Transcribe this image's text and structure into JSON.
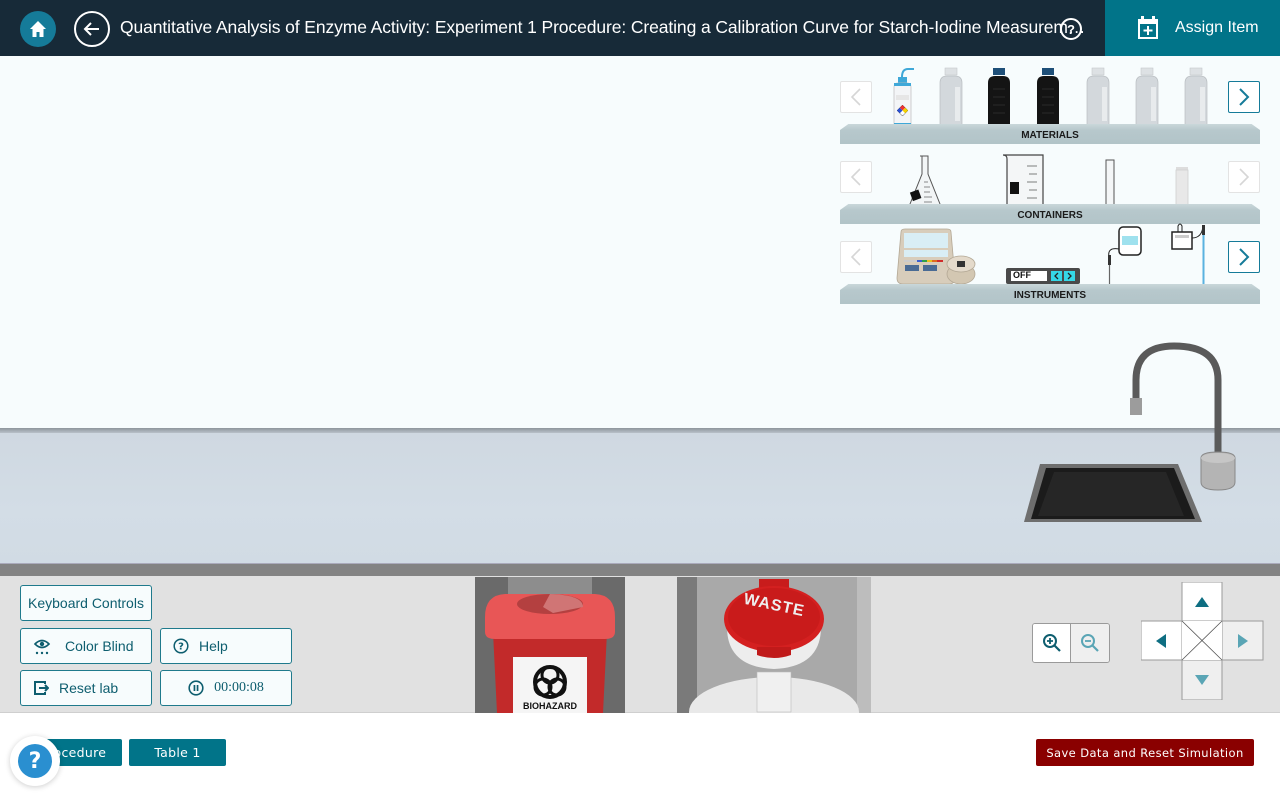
{
  "header": {
    "title": "Quantitative Analysis of Enzyme Activity: Experiment 1 Procedure: Creating a Calibration Curve for Starch-Iodine Measurem…",
    "help_symbol": "?",
    "assign_label": "Assign Item",
    "icons": {
      "home": "home-icon",
      "back": "arrow-left-icon",
      "help": "question-circle-icon",
      "assign": "calendar-plus-icon"
    }
  },
  "shelves": [
    {
      "label": "MATERIALS",
      "items": [
        "wash-bottle",
        "clear-reagent-bottle",
        "amber-reagent-bottle",
        "amber-reagent-bottle",
        "clear-reagent-bottle",
        "clear-reagent-bottle",
        "clear-reagent-bottle"
      ],
      "prev_enabled": false,
      "next_enabled": true
    },
    {
      "label": "CONTAINERS",
      "items": [
        "erlenmeyer-flask",
        "beaker",
        "test-tube",
        "cuvette"
      ],
      "prev_enabled": false,
      "next_enabled": false
    },
    {
      "label": "INSTRUMENTS",
      "items": [
        "spectrophotometer",
        "hot-plate",
        "thermometer-probe",
        "ph-meter"
      ],
      "prev_enabled": false,
      "next_enabled": true,
      "hot_plate_display": "OFF"
    }
  ],
  "controls": {
    "keyboard_controls": "Keyboard Controls",
    "color_blind": "Color Blind",
    "help": "Help",
    "reset_lab": "Reset lab",
    "timer": "00:00:08"
  },
  "disposal": {
    "biohazard_label": "BIOHAZARD",
    "waste_label": "WASTE"
  },
  "footer": {
    "tabs": [
      "Procedure",
      "Table 1"
    ],
    "save_reset": "Save Data and Reset Simulation",
    "help_fab": "?"
  },
  "colors": {
    "header_bg": "#172a38",
    "accent": "#017489",
    "danger": "#8a0000"
  }
}
